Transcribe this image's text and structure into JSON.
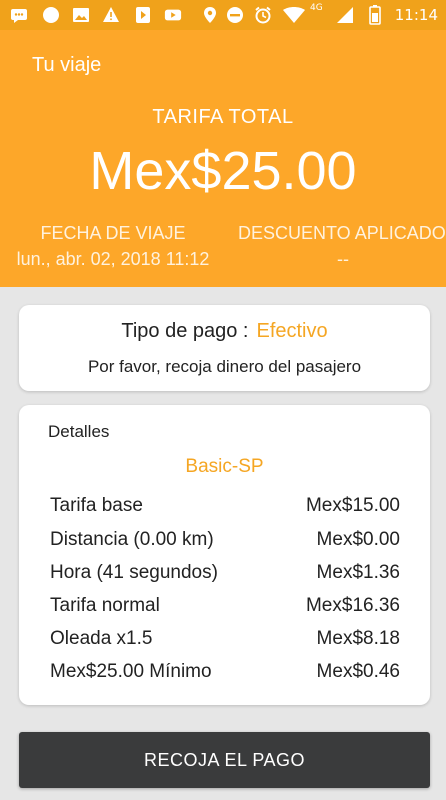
{
  "status_bar": {
    "time": "11:14",
    "network": "4G",
    "icons": [
      "messages-icon",
      "circle-icon",
      "gallery-icon",
      "warning-icon",
      "play-store-icon",
      "youtube-icon",
      "location-icon",
      "do-not-disturb-icon",
      "alarm-icon",
      "wifi-icon",
      "signal-icon",
      "battery-icon"
    ]
  },
  "header": {
    "trip_label": "Tu viaje",
    "total_label": "TARIFA TOTAL",
    "total_amount": "Mex$25.00",
    "date_label": "FECHA DE VIAJE",
    "date_value": "lun., abr. 02, 2018 11:12",
    "discount_label": "DESCUENTO APLICADO",
    "discount_value": "--"
  },
  "payment": {
    "label": "Tipo de pago :",
    "value": "Efectivo",
    "note": "Por favor, recoja dinero del pasajero"
  },
  "details": {
    "title": "Detalles",
    "service": "Basic-SP",
    "rows": [
      {
        "label": "Tarifa base",
        "value": "Mex$15.00"
      },
      {
        "label": "Distancia (0.00 km)",
        "value": "Mex$0.00"
      },
      {
        "label": "Hora (41 segundos)",
        "value": "Mex$1.36"
      },
      {
        "label": "Tarifa normal",
        "value": "Mex$16.36"
      },
      {
        "label": "Oleada x1.5",
        "value": "Mex$8.18"
      },
      {
        "label": "Mex$25.00 Mínimo",
        "value": "Mex$0.46"
      }
    ]
  },
  "action": {
    "collect_label": "RECOJA EL PAGO"
  },
  "colors": {
    "header_orange": "#fda729",
    "status_orange": "#f0a21b",
    "accent_orange": "#f5a623",
    "button_dark": "#3a3b3c"
  }
}
